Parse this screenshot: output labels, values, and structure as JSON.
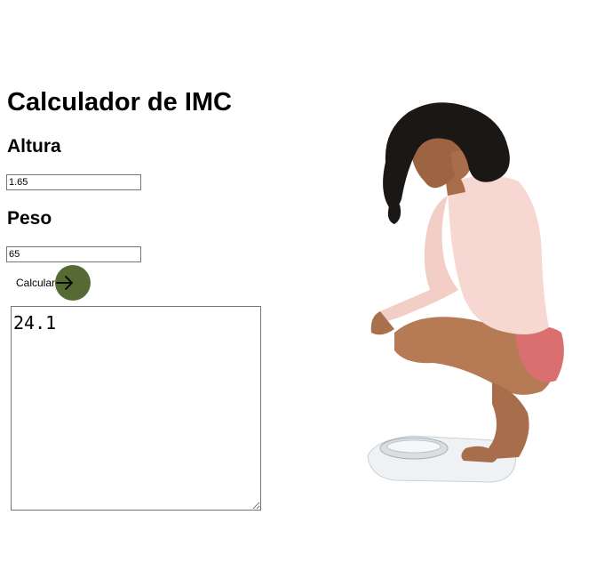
{
  "page": {
    "title": "Calculador de IMC"
  },
  "form": {
    "altura_label": "Altura",
    "altura_value": "1.65",
    "peso_label": "Peso",
    "peso_value": "65",
    "calc_button_label": "Calcular",
    "result_value": "24.1"
  },
  "icons": {
    "button_icon": "arrow-right-icon"
  },
  "colors": {
    "button_circle": "#566b33",
    "background": "#ffffff"
  },
  "image": {
    "subject": "woman-crouching-on-scale"
  }
}
